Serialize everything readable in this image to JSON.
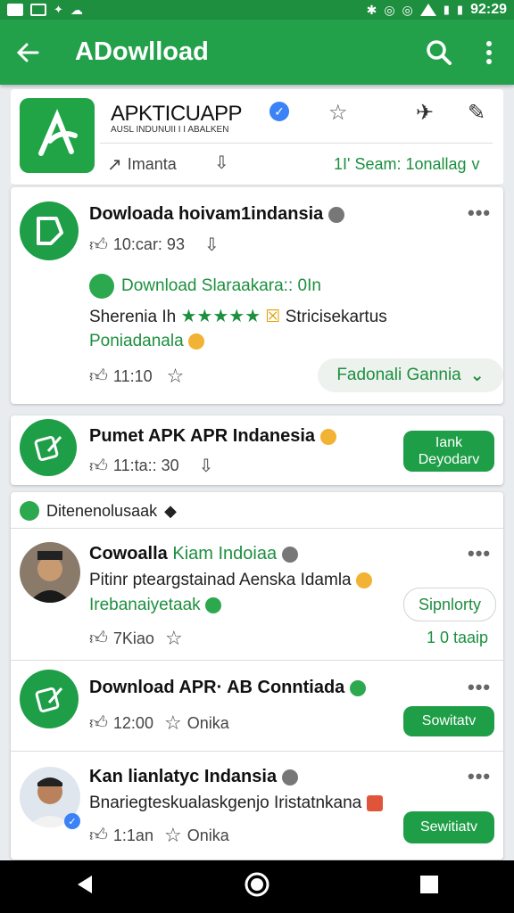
{
  "status_bar": {
    "time": "92:29"
  },
  "app_bar": {
    "title": "ADowlload"
  },
  "header_card": {
    "app_name": "APKTICUAPP",
    "subtitle": "AUSL INDUNUII I  I  ABALKEN",
    "share_label": "Imanta",
    "seam_label": "1I' Seam: 1onallag",
    "chevron": "v"
  },
  "post1": {
    "title": "Dowloada hoivam1indansia",
    "meta": "10:car: 93",
    "download_line": "Download Slaraakara:: 0In",
    "line2_prefix": "Sherenia Ih",
    "stars": "★★★★★",
    "line2_suffix": "Stricisekartus",
    "line3": "Poniadanala",
    "like_time": "11:10",
    "action_pill": "Fadonali Gannia"
  },
  "post2": {
    "title": "Pumet APK APR Indanesia",
    "meta": "11:ta:: 30",
    "button": "Iank\nDeyodarv"
  },
  "section": {
    "label": "Ditenenolusaak"
  },
  "post3": {
    "title": "Cowoalla",
    "title_green": "Kiam Indoiaa",
    "line1": "Pitinr pteargstainad Aenska Idamla",
    "line2": "Irebanaiyetaak",
    "like_time": "7Kiao",
    "button": "Sipnlorty",
    "count": "1 0 taaip"
  },
  "post4": {
    "title": "Download APR· AB Conntiada",
    "meta": "12:00",
    "meta2": "Onika",
    "button": "Sowitatv"
  },
  "post5": {
    "title": "Kan lianlatyc Indansia",
    "line1": "Bnariegteskualaskgenjo Iristatnkana",
    "meta": "1:1an",
    "meta2": "Onika",
    "button": "Sewitiatv"
  },
  "colors": {
    "primary": "#23a14a",
    "primary_dark": "#1d8f3f",
    "accent_blue": "#3b82f6"
  }
}
